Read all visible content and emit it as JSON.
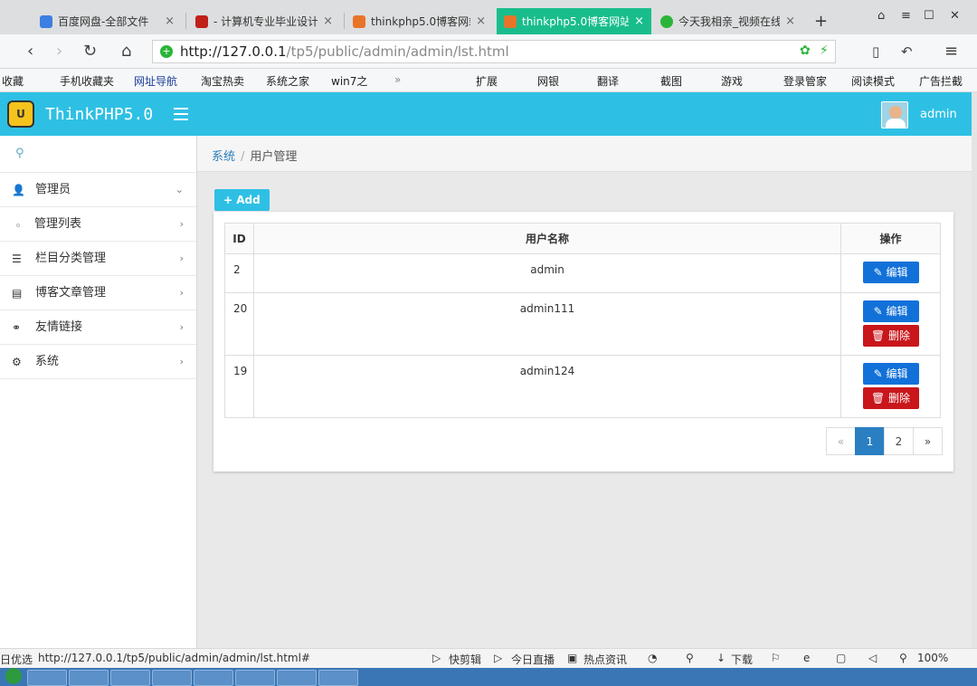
{
  "browser": {
    "tabs": [
      {
        "label": "百度网盘-全部文件",
        "color": "#3b7fe0"
      },
      {
        "label": "- 计算机专业毕业设计",
        "color": "#c0201a"
      },
      {
        "label": "thinkphp5.0博客网站",
        "color": "#e8742a"
      },
      {
        "label": "thinkphp5.0博客网站",
        "color": "#e8742a",
        "active": true
      },
      {
        "label": "今天我相亲_视频在线",
        "color": "#2ab53a"
      }
    ],
    "new_tab": "+",
    "url_host": "http://127.0.0.1",
    "url_path": "/tp5/public/admin/admin/lst.html",
    "bookmarks": [
      "收藏",
      "手机收藏夹",
      "网址导航",
      "淘宝热卖",
      "系统之家",
      "win7之",
      "»",
      "扩展",
      "网银",
      "翻译",
      "截图",
      "游戏",
      "登录管家",
      "阅读模式",
      "广告拦截"
    ]
  },
  "header": {
    "logo_text": "U",
    "brand": "ThinkPHP5.0",
    "user": "admin"
  },
  "sidebar": {
    "items": [
      {
        "label": "管理员",
        "icon": "user-icon",
        "glyph": "👤",
        "arrow": "⌄"
      },
      {
        "label": "管理列表",
        "sub": true,
        "arrow": "›"
      },
      {
        "label": "栏目分类管理",
        "icon": "list-icon",
        "glyph": "☰",
        "arrow": "›"
      },
      {
        "label": "博客文章管理",
        "icon": "document-icon",
        "glyph": "▤",
        "arrow": "›"
      },
      {
        "label": "友情链接",
        "icon": "link-icon",
        "glyph": "⚭",
        "arrow": "›"
      },
      {
        "label": "系统",
        "icon": "gear-icon",
        "glyph": "⚙",
        "arrow": "›"
      }
    ]
  },
  "breadcrumb": {
    "home": "系统",
    "sep": "/",
    "current": "用户管理"
  },
  "add_button": "+ Add",
  "table": {
    "headers": [
      "ID",
      "用户名称",
      "操作"
    ],
    "rows": [
      {
        "id": "2",
        "name": "admin",
        "actions": [
          "编辑"
        ]
      },
      {
        "id": "20",
        "name": "admin111",
        "actions": [
          "编辑",
          "删除"
        ]
      },
      {
        "id": "19",
        "name": "admin124",
        "actions": [
          "编辑",
          "删除"
        ]
      }
    ],
    "edit_icon": "✎",
    "delete_icon": "🗑"
  },
  "pagination": {
    "prev": "«",
    "pages": [
      "1",
      "2"
    ],
    "current": "1",
    "next": "»"
  },
  "statusbar": {
    "left": "日优选",
    "url": "http://127.0.0.1/tp5/public/admin/admin/lst.html#",
    "items": [
      "快剪辑",
      "今日直播",
      "热点资讯",
      "下载"
    ],
    "zoom": "100%"
  }
}
